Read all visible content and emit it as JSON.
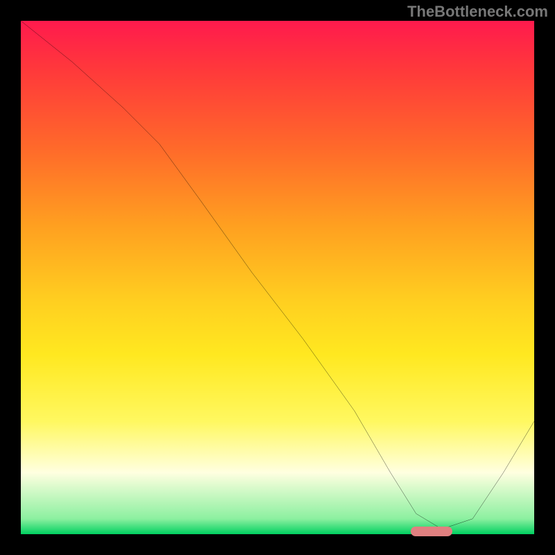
{
  "attribution": "TheBottleneck.com",
  "chart_data": {
    "type": "line",
    "title": "",
    "xlabel": "",
    "ylabel": "",
    "xlim": [
      0,
      100
    ],
    "ylim": [
      0,
      100
    ],
    "grid": false,
    "legend": false,
    "series": [
      {
        "name": "bottleneck-curve",
        "x": [
          0,
          10,
          20,
          27,
          35,
          45,
          55,
          65,
          72,
          77,
          82,
          88,
          94,
          100
        ],
        "y": [
          100,
          92,
          83,
          76,
          65,
          51,
          38,
          24,
          12,
          4,
          1,
          3,
          12,
          22
        ]
      }
    ],
    "optimal_marker": {
      "x_start": 76,
      "x_end": 84,
      "y": 0.5
    },
    "background_gradient": {
      "top": "#ff1a4d",
      "mid": "#ffe820",
      "bottom": "#00d060"
    }
  }
}
